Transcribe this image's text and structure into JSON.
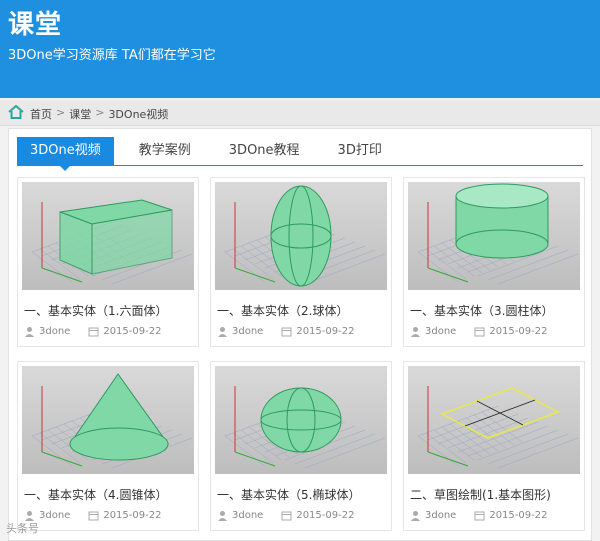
{
  "header": {
    "title": "课堂",
    "subtitle": "3DOne学习资源库  TA们都在学习它"
  },
  "breadcrumb": {
    "home_icon": "home-icon",
    "items": [
      "首页",
      "课堂",
      "3DOne视频"
    ],
    "separator": ">"
  },
  "tabs": [
    {
      "label": "3DOne视频",
      "active": true
    },
    {
      "label": "教学案例",
      "active": false
    },
    {
      "label": "3DOne教程",
      "active": false
    },
    {
      "label": "3D打印",
      "active": false
    }
  ],
  "cards": [
    {
      "title": "一、基本实体（1.六面体）",
      "author": "3done",
      "date": "2015-09-22",
      "shape": "box"
    },
    {
      "title": "一、基本实体（2.球体）",
      "author": "3done",
      "date": "2015-09-22",
      "shape": "sphere"
    },
    {
      "title": "一、基本实体（3.圆柱体）",
      "author": "3done",
      "date": "2015-09-22",
      "shape": "cylinder"
    },
    {
      "title": "一、基本实体（4.圆锥体）",
      "author": "3done",
      "date": "2015-09-22",
      "shape": "cone"
    },
    {
      "title": "一、基本实体（5.椭球体）",
      "author": "3done",
      "date": "2015-09-22",
      "shape": "ellipsoid"
    },
    {
      "title": "二、草图绘制(1.基本图形)",
      "author": "3done",
      "date": "2015-09-22",
      "shape": "sketch"
    }
  ],
  "watermark": "头条号",
  "colors": {
    "accent": "#1a8ae0",
    "banner": "#1f8fe0",
    "shape_fill": "#7fd8a6",
    "shape_edge": "#2f9a5e"
  }
}
